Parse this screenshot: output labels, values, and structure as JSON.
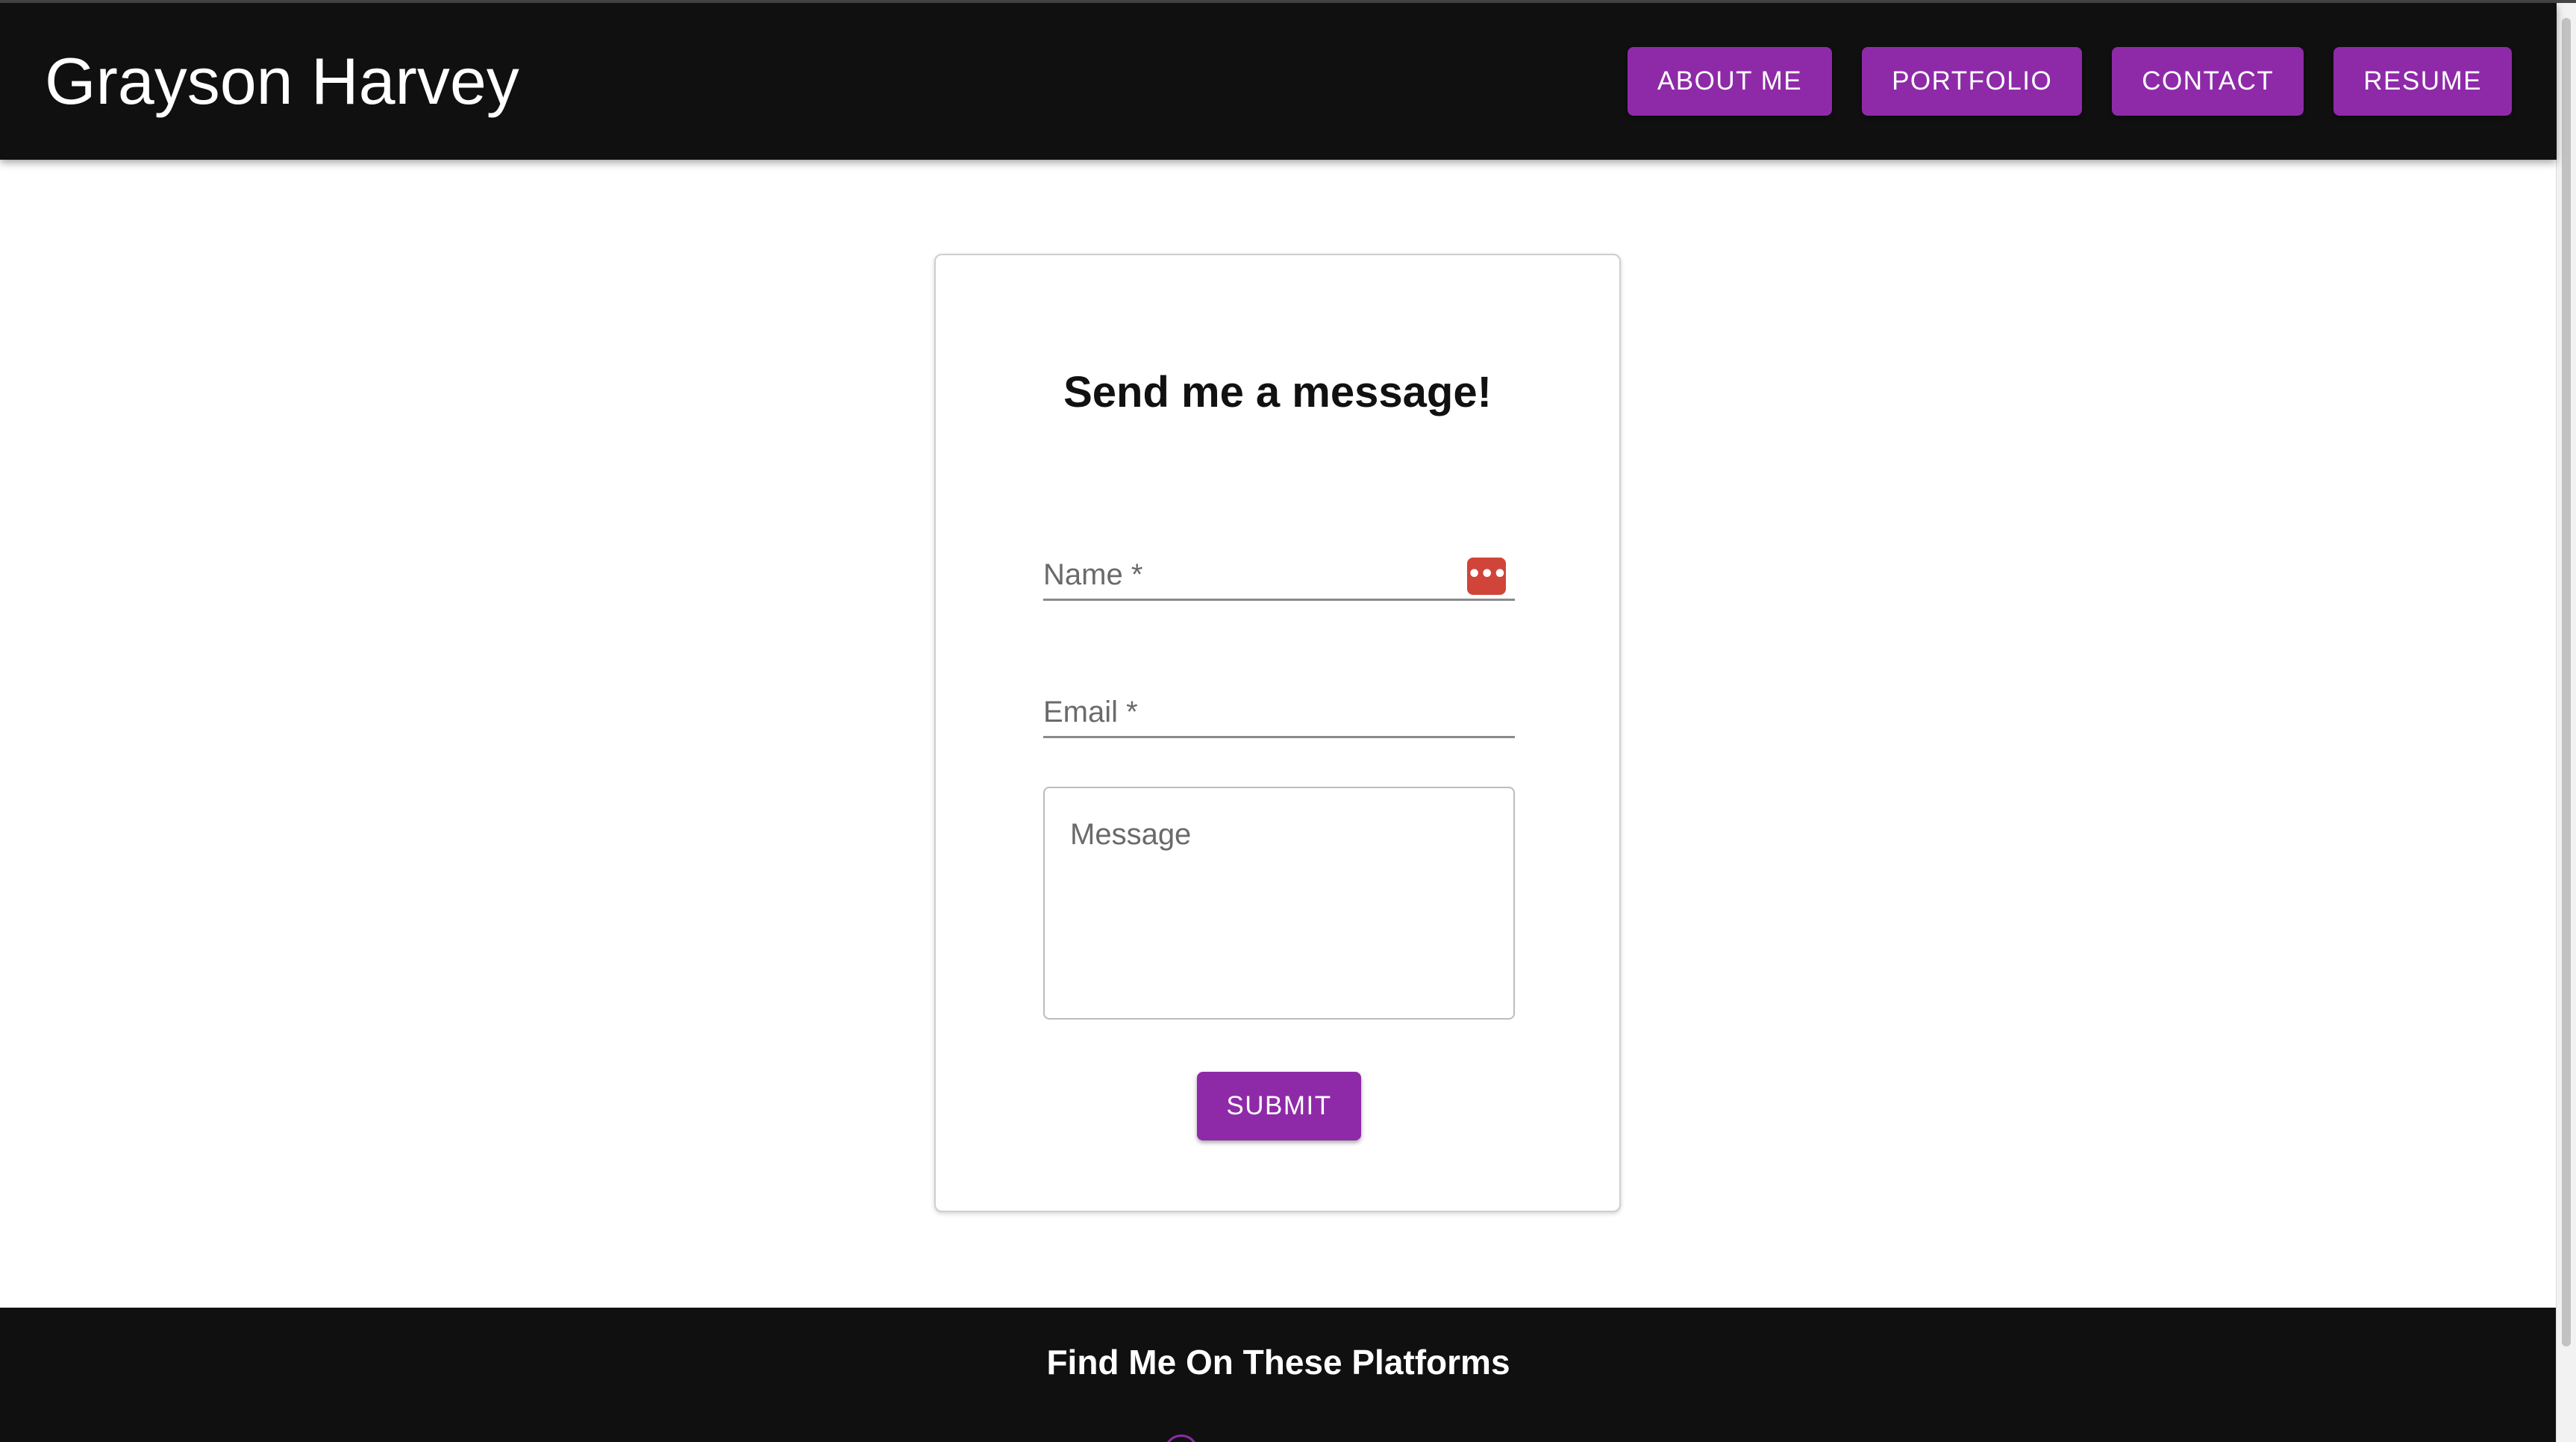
{
  "header": {
    "brand": "Grayson Harvey",
    "nav": [
      {
        "label": "ABOUT ME"
      },
      {
        "label": "PORTFOLIO"
      },
      {
        "label": "CONTACT"
      },
      {
        "label": "RESUME"
      }
    ]
  },
  "contact_form": {
    "title": "Send me a message!",
    "name_label": "Name *",
    "email_label": "Email *",
    "message_placeholder": "Message",
    "submit_label": "SUBMIT",
    "password_manager_icon": "•••|"
  },
  "footer": {
    "title": "Find Me On These Platforms"
  },
  "colors": {
    "header_bg": "#101010",
    "accent": "#8e2aa8",
    "password_icon": "#d0443a"
  }
}
